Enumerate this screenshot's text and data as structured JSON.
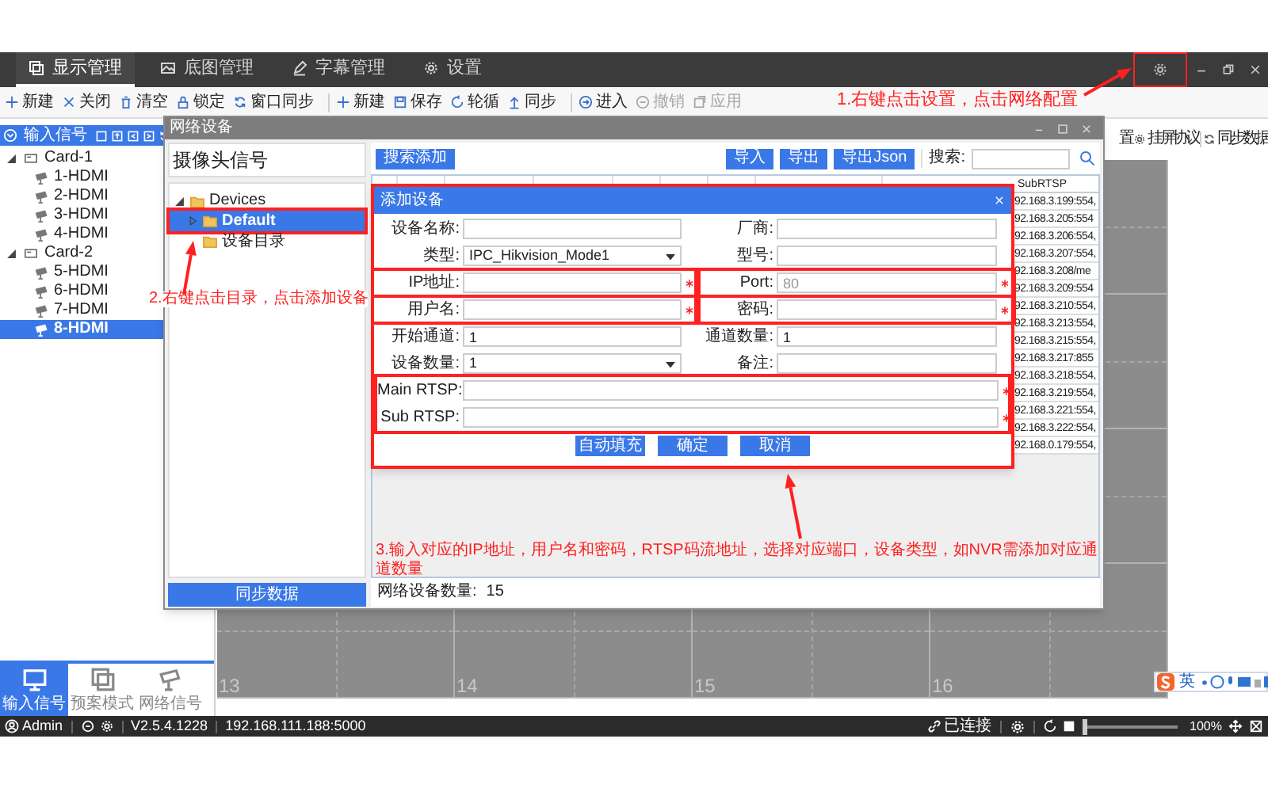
{
  "app_tabs": [
    {
      "label": "显示管理",
      "selected": true
    },
    {
      "label": "底图管理",
      "selected": false
    },
    {
      "label": "字幕管理",
      "selected": false
    },
    {
      "label": "设置",
      "selected": false
    }
  ],
  "title_bar": {
    "settings_button": {
      "highlighted": true
    }
  },
  "toolbar": [
    {
      "items": [
        {
          "label": "新建",
          "disabled": false
        },
        {
          "label": "关闭",
          "disabled": false
        },
        {
          "label": "清空",
          "disabled": false
        },
        {
          "label": "锁定",
          "disabled": false
        },
        {
          "label": "窗口同步",
          "disabled": false
        }
      ]
    },
    {
      "items": [
        {
          "label": "新建",
          "disabled": false
        },
        {
          "label": "保存",
          "disabled": false
        },
        {
          "label": "轮循",
          "disabled": false
        },
        {
          "label": "同步",
          "disabled": false
        }
      ]
    },
    {
      "items": [
        {
          "label": "进入",
          "disabled": false
        },
        {
          "label": "撤销",
          "disabled": true
        },
        {
          "label": "应用",
          "disabled": true
        }
      ]
    }
  ],
  "right_toolbar": [
    {
      "label": "置"
    },
    {
      "label": "挂屏协议"
    },
    {
      "label": "同步数据"
    }
  ],
  "input_panel": {
    "title": "输入信号",
    "tree": [
      {
        "label": "Card-1",
        "expanded": true,
        "children": [
          {
            "label": "1-HDMI",
            "selected": false
          },
          {
            "label": "2-HDMI",
            "selected": false
          },
          {
            "label": "3-HDMI",
            "selected": false
          },
          {
            "label": "4-HDMI",
            "selected": false
          }
        ]
      },
      {
        "label": "Card-2",
        "expanded": true,
        "children": [
          {
            "label": "5-HDMI",
            "selected": false
          },
          {
            "label": "6-HDMI",
            "selected": false
          },
          {
            "label": "7-HDMI",
            "selected": false
          },
          {
            "label": "8-HDMI",
            "selected": true
          }
        ]
      }
    ]
  },
  "bottom_tabs": [
    {
      "label": "输入信号",
      "selected": true
    },
    {
      "label": "预案模式",
      "selected": false
    },
    {
      "label": "网络信号",
      "selected": false
    }
  ],
  "canvas": {
    "cell_numbers": [
      "13",
      "14",
      "15",
      "16"
    ]
  },
  "network_window": {
    "title": "网络设备",
    "camera_header": "摄像头信号",
    "tree": [
      {
        "label": "Devices",
        "expanded": true,
        "children": [
          {
            "label": "Default",
            "expanded": false,
            "selected": true,
            "highlighted": true
          },
          {
            "label": "设备目录",
            "selected": false,
            "highlighted": false
          }
        ]
      }
    ],
    "sync_button": "同步数据",
    "add_button": "搜索添加",
    "buttons": [
      "导入",
      "导出",
      "导出Json"
    ],
    "search_label": "搜索:",
    "table": {
      "columns": [
        "SubRTSP"
      ],
      "rows": [
        "92.168.3.199:554,",
        "92.168.3.205:554",
        "92.168.3.206:554,",
        "92.168.3.207:554,",
        "92.168.3.208/me",
        "92.168.3.209:554",
        "92.168.3.210:554,",
        "92.168.3.213:554,",
        "92.168.3.215:554,",
        "92.168.3.217:855",
        "92.168.3.218:554,",
        "92.168.3.219:554,",
        "92.168.3.221:554,",
        "92.168.3.222:554,",
        "92.168.0.179:554,"
      ]
    },
    "count_label": "网络设备数量:",
    "count": "15"
  },
  "add_dialog": {
    "title": "添加设备",
    "highlighted": true,
    "rows": [
      [
        {
          "label": "设备名称:",
          "kind": "text",
          "required": false,
          "highlighted": false
        },
        {
          "label": "厂商:",
          "kind": "text",
          "required": false,
          "highlighted": false
        }
      ],
      [
        {
          "label": "类型:",
          "kind": "select",
          "value": "IPC_Hikvision_Mode1",
          "required": false,
          "highlighted": false
        },
        {
          "label": "型号:",
          "kind": "text",
          "required": false,
          "highlighted": false
        }
      ],
      [
        {
          "label": "IP地址:",
          "kind": "text",
          "required": true,
          "highlighted": true
        },
        {
          "label": "Port:",
          "kind": "text",
          "placeholder": "80",
          "required": true,
          "highlighted": true
        }
      ],
      [
        {
          "label": "用户名:",
          "kind": "text",
          "required": true,
          "highlighted": true
        },
        {
          "label": "密码:",
          "kind": "text",
          "required": true,
          "highlighted": true
        }
      ],
      [
        {
          "label": "开始通道:",
          "kind": "text",
          "value": "1",
          "required": false,
          "highlighted": false
        },
        {
          "label": "通道数量:",
          "kind": "text",
          "value": "1",
          "required": false,
          "highlighted": false
        }
      ],
      [
        {
          "label": "设备数量:",
          "kind": "select",
          "value": "1",
          "required": false,
          "highlighted": false
        },
        {
          "label": "备注:",
          "kind": "text",
          "required": false,
          "highlighted": false
        }
      ]
    ],
    "rtsp": {
      "highlighted": true,
      "fields": [
        {
          "label": "Main RTSP:",
          "required": true
        },
        {
          "label": "Sub RTSP:",
          "required": true
        }
      ]
    },
    "buttons": [
      "自动填充",
      "确定",
      "取消"
    ]
  },
  "status_bar": {
    "user": "Admin",
    "version": "V2.5.4.1228",
    "address": "192.168.111.188:5000",
    "connection": "已连接",
    "zoom_slider": {
      "level": 0
    },
    "zoom": "100%"
  },
  "ime_toolbar": {
    "mode": "英"
  },
  "annotations": [
    {
      "text": "1.右键点击设置，点击网络配置"
    },
    {
      "text": "2.右键点击目录，点击添加设备"
    },
    {
      "text": "3.输入对应的IP地址，用户名和密码，RTSP码流地址，选择对应端口，设备类型，如NVR需添加对应通道数量"
    }
  ]
}
